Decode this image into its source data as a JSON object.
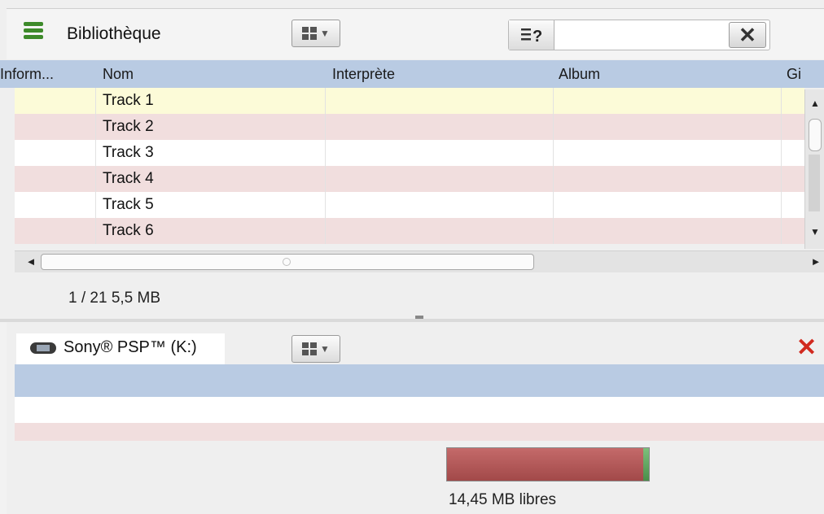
{
  "library": {
    "title": "Bibliothèque",
    "view_icon": "grid-view-icon",
    "search": {
      "icon": "search-help-icon",
      "value": "",
      "clear_icon": "close-icon"
    },
    "columns": [
      "Inform...",
      "Nom",
      "Interprète",
      "Album",
      "Gi"
    ],
    "tracks": [
      {
        "name": "Track 1",
        "artist": "",
        "album": ""
      },
      {
        "name": "Track 2",
        "artist": "",
        "album": ""
      },
      {
        "name": "Track 3",
        "artist": "",
        "album": ""
      },
      {
        "name": "Track 4",
        "artist": "",
        "album": ""
      },
      {
        "name": "Track 5",
        "artist": "",
        "album": ""
      },
      {
        "name": "Track 6",
        "artist": "",
        "album": ""
      }
    ],
    "row_colors": {
      "selected": "#fcfbd8",
      "odd": "#f1dede",
      "even": "#ffffff"
    },
    "status": "1 / 21  5,5 MB"
  },
  "device": {
    "name": "Sony® PSP™ (K:)",
    "icon": "psp-device-icon",
    "view_icon": "grid-view-icon",
    "close_icon": "close-icon",
    "capacity": {
      "used_fraction": 0.97,
      "free_text": "14,45 MB libres"
    }
  },
  "colors": {
    "header_blue": "#b9cbe3",
    "used": "#b05555",
    "free": "#5aa55a",
    "close_red": "#d12a1f"
  }
}
